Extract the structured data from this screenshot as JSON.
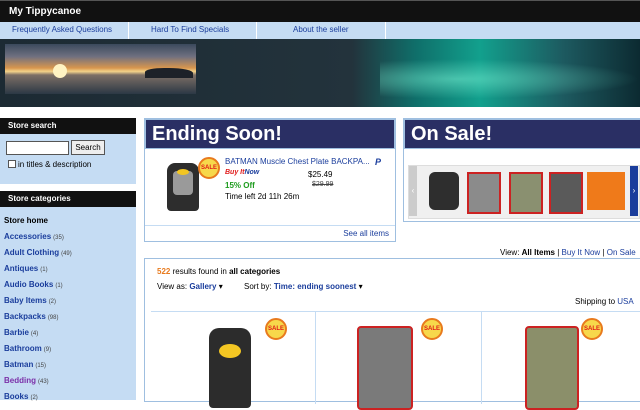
{
  "store": {
    "title": "My Tippycanoe"
  },
  "nav": {
    "items": [
      "Frequently Asked Questions",
      "Hard To Find Specials",
      "About the seller"
    ]
  },
  "search": {
    "heading": "Store search",
    "button": "Search",
    "checkbox_label": "in titles & description",
    "value": ""
  },
  "categories": {
    "heading": "Store categories",
    "home": "Store home",
    "items": [
      {
        "label": "Accessories",
        "count": "(35)"
      },
      {
        "label": "Adult Clothing",
        "count": "(49)"
      },
      {
        "label": "Antiques",
        "count": "(1)"
      },
      {
        "label": "Audio Books",
        "count": "(1)"
      },
      {
        "label": "Baby Items",
        "count": "(2)"
      },
      {
        "label": "Backpacks",
        "count": "(98)"
      },
      {
        "label": "Barbie",
        "count": "(4)"
      },
      {
        "label": "Bathroom",
        "count": "(9)"
      },
      {
        "label": "Batman",
        "count": "(15)"
      },
      {
        "label": "Bedding",
        "count": "(43)"
      },
      {
        "label": "Books",
        "count": "(2)"
      }
    ]
  },
  "ending": {
    "heading": "Ending Soon!",
    "sale_badge": "SALE",
    "item_title": "BATMAN Muscle Chest Plate BACKPA...",
    "paypal_icon": "paypal-icon",
    "buy_it_now_1": "Buy It",
    "buy_it_now_2": "Now",
    "price": "$25.49",
    "pct_off": "15% Off",
    "old_price": "$29.99",
    "time_left": "Time left 2d 11h 26m",
    "see_all": "See all items"
  },
  "onsale": {
    "heading": "On Sale!",
    "left_arrow": "‹",
    "right_arrow": "›"
  },
  "view": {
    "label": "View:",
    "all": "All Items",
    "sep1": " | ",
    "bin": "Buy It Now",
    "sep2": " | ",
    "onsale": "On Sale"
  },
  "results": {
    "count": "522",
    "found_text": " results found in ",
    "in_cat": "all categories",
    "view_as_label": "View as:",
    "view_as_value": "Gallery",
    "sort_label": "Sort by:",
    "sort_value": "Time: ending soonest",
    "shipping_label": "Shipping to",
    "shipping_value": "USA",
    "sale_badge": "SALE"
  },
  "colors": {
    "nav_bg": "#c5dcf3",
    "panel_head": "#2a2f64",
    "link": "#1a3d9c",
    "sale_red": "#e01818",
    "green": "#1d9b1d"
  }
}
